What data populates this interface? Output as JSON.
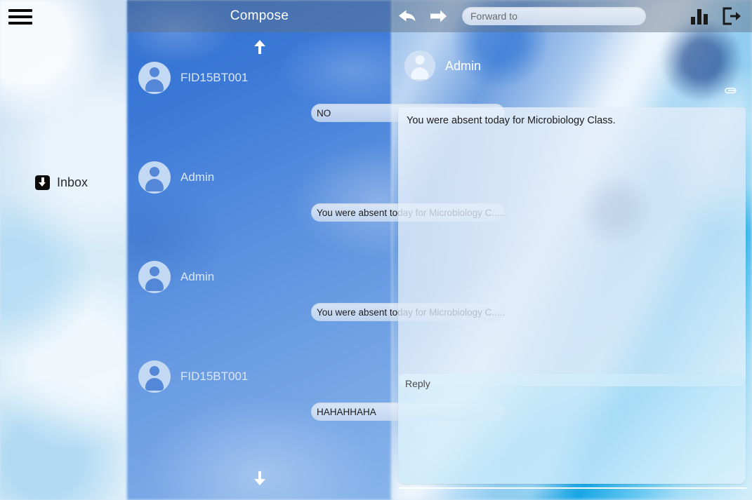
{
  "sidebar": {
    "menu_icon": "hamburger-menu-icon",
    "items": [
      {
        "label": "Inbox",
        "icon": "inbox-tray-icon"
      }
    ]
  },
  "compose_panel": {
    "title": "Compose",
    "scroll_up_icon": "arrow-up-icon",
    "scroll_down_icon": "arrow-down-icon",
    "messages": [
      {
        "sender": "FID15BT001",
        "preview": "NO",
        "avatar": "person-avatar-icon"
      },
      {
        "sender": "Admin",
        "preview": "You were absent today for Microbiology C.....",
        "avatar": "person-avatar-icon"
      },
      {
        "sender": "Admin",
        "preview": "You were absent today for Microbiology C.....",
        "avatar": "person-avatar-icon"
      },
      {
        "sender": "FID15BT001",
        "preview": "HAHAHHAHA",
        "avatar": "person-avatar-icon"
      }
    ]
  },
  "toolbar": {
    "reply_icon": "reply-arrow-icon",
    "forward_icon": "forward-arrow-icon",
    "forward_to": {
      "value": "",
      "placeholder": "Forward to"
    },
    "stats_icon": "bar-chart-icon",
    "logout_icon": "logout-icon"
  },
  "reading_pane": {
    "sender": "Admin",
    "avatar": "person-avatar-icon",
    "attachment_icon": "paperclip-icon",
    "body": "You were absent today for Microbiology Class.",
    "reply": {
      "value": "",
      "placeholder": "Reply"
    }
  },
  "colors": {
    "accent_blue": "#3d7ad8",
    "topbar_overlay": "#606e82",
    "bubble_light": "#ecf2fa",
    "text_dark": "#1c1c1c",
    "text_light": "#ffffff"
  }
}
